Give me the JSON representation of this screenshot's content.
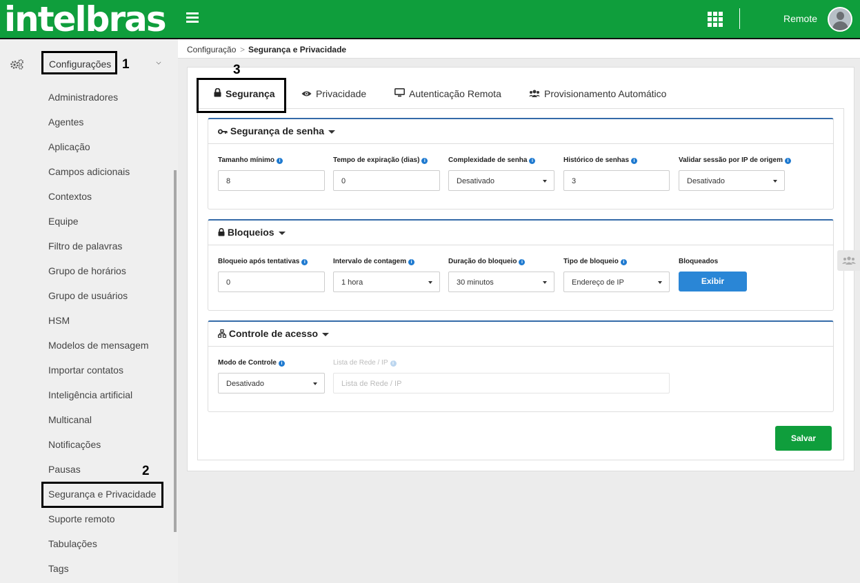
{
  "header": {
    "logo": "intelbras",
    "user_name": "Remote"
  },
  "sidebar": {
    "section_label": "Configurações",
    "items": [
      "Administradores",
      "Agentes",
      "Aplicação",
      "Campos adicionais",
      "Contextos",
      "Equipe",
      "Filtro de palavras",
      "Grupo de horários",
      "Grupo de usuários",
      "HSM",
      "Modelos de mensagem",
      "Importar contatos",
      "Inteligência artificial",
      "Multicanal",
      "Notificações",
      "Pausas",
      "Segurança e Privacidade",
      "Suporte remoto",
      "Tabulações",
      "Tags"
    ]
  },
  "annotations": {
    "n1": "1",
    "n2": "2",
    "n3": "3"
  },
  "breadcrumb": {
    "home": "Configuração",
    "sep": ">",
    "current": "Segurança e Privacidade"
  },
  "tabs": [
    "Segurança",
    "Privacidade",
    "Autenticação Remota",
    "Provisionamento Automático"
  ],
  "password_section": {
    "title": "Segurança de senha",
    "fields": {
      "min_size": {
        "label": "Tamanho mínimo",
        "value": "8"
      },
      "expiration": {
        "label": "Tempo de expiração (dias)",
        "value": "0"
      },
      "complexity": {
        "label": "Complexidade de senha",
        "value": "Desativado"
      },
      "history": {
        "label": "Histórico de senhas",
        "value": "3"
      },
      "ip_session": {
        "label": "Validar sessão por IP de origem",
        "value": "Desativado"
      }
    }
  },
  "lock_section": {
    "title": "Bloqueios",
    "fields": {
      "attempts": {
        "label": "Bloqueio após tentativas",
        "value": "0"
      },
      "interval": {
        "label": "Intervalo de contagem",
        "value": "1 hora"
      },
      "duration": {
        "label": "Duração do bloqueio",
        "value": "30 minutos"
      },
      "type": {
        "label": "Tipo de bloqueio",
        "value": "Endereço de IP"
      },
      "blocked": {
        "label": "Bloqueados",
        "button": "Exibir"
      }
    }
  },
  "access_section": {
    "title": "Controle de acesso",
    "fields": {
      "mode": {
        "label": "Modo de Controle",
        "value": "Desativado"
      },
      "network_list": {
        "label": "Lista de Rede / IP",
        "placeholder": "Lista de Rede / IP"
      }
    }
  },
  "save_button": "Salvar",
  "colors": {
    "brand_green": "#0f9e3c",
    "accent_blue": "#2a86d6",
    "section_border": "#336aa8"
  }
}
